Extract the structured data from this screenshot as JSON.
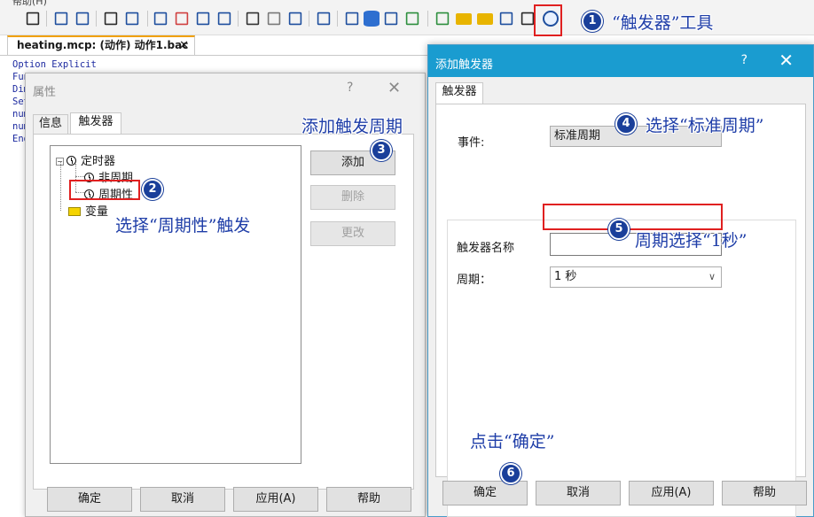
{
  "menu_hint": "帮助(H)",
  "toolbar": {
    "icons": [
      "pointer-icon",
      "indent-icon",
      "outdent-icon",
      "list-icon",
      "list-indent-icon",
      "pen-icon",
      "pen-star-icon",
      "pen-remove-icon",
      "pen-add-icon",
      "binoculars-icon",
      "cut-icon",
      "graph-icon",
      "pin-icon",
      "window-icon",
      "database-icon",
      "calendar-icon",
      "chart-icon",
      "export-icon",
      "folder-icon",
      "folder-add-icon",
      "draw-icon",
      "compass-icon",
      "trigger-clock-icon"
    ]
  },
  "document_tab": {
    "label": "heating.mcp: (动作) 动作1.bac",
    "close": "✕"
  },
  "code": [
    "Option Explicit",
    "Fun",
    "Dim",
    "Set",
    "num",
    "num",
    "End"
  ],
  "properties_dialog": {
    "title": "属性",
    "help": "?",
    "close": "✕",
    "tabs": [
      "信息",
      "触发器"
    ],
    "tree": {
      "root": "定时器",
      "children": [
        "非周期",
        "周期性"
      ],
      "other": "变量"
    },
    "buttons": {
      "add": "添加",
      "delete": "删除",
      "change": "更改"
    },
    "footer": {
      "ok": "确定",
      "cancel": "取消",
      "apply": "应用(A)",
      "help": "帮助"
    }
  },
  "add_trigger_dialog": {
    "title": "添加触发器",
    "help": "?",
    "close": "✕",
    "tab": "触发器",
    "event_label": "事件:",
    "event_value": "标准周期",
    "name_label": "触发器名称",
    "name_value": "",
    "period_label": "周期：",
    "period_value": "1 秒",
    "footer": {
      "ok": "确定",
      "cancel": "取消",
      "apply": "应用(A)",
      "help": "帮助"
    }
  },
  "annotations": [
    {
      "num": "1",
      "text": "“触发器”工具"
    },
    {
      "num": "2",
      "text": "选择“周期性”触发"
    },
    {
      "num": "3",
      "text": "添加触发周期"
    },
    {
      "num": "4",
      "text": "选择“标准周期”"
    },
    {
      "num": "5",
      "text": "周期选择“1秒”"
    },
    {
      "num": "6",
      "text": "点击“确定”"
    }
  ],
  "colors": {
    "titlebar": "#1a9cd0",
    "annotation": "#1f3ea8",
    "badge": "#1a3f9a",
    "highlight": "#e02020"
  }
}
